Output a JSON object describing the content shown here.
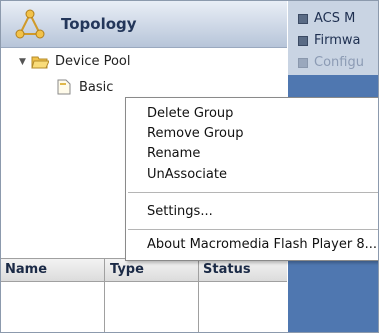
{
  "topology": {
    "title": "Topology"
  },
  "tree": {
    "root_label": "Device Pool",
    "child_label": "Basic"
  },
  "right_panel": {
    "items": [
      "ACS M",
      "Firmwa",
      "Configu"
    ]
  },
  "table": {
    "columns": [
      "Name",
      "Type",
      "Status"
    ]
  },
  "context_menu": {
    "items": [
      "Delete Group",
      "Remove Group",
      "Rename",
      "UnAssociate",
      "Settings...",
      "About Macromedia Flash Player 8..."
    ]
  }
}
